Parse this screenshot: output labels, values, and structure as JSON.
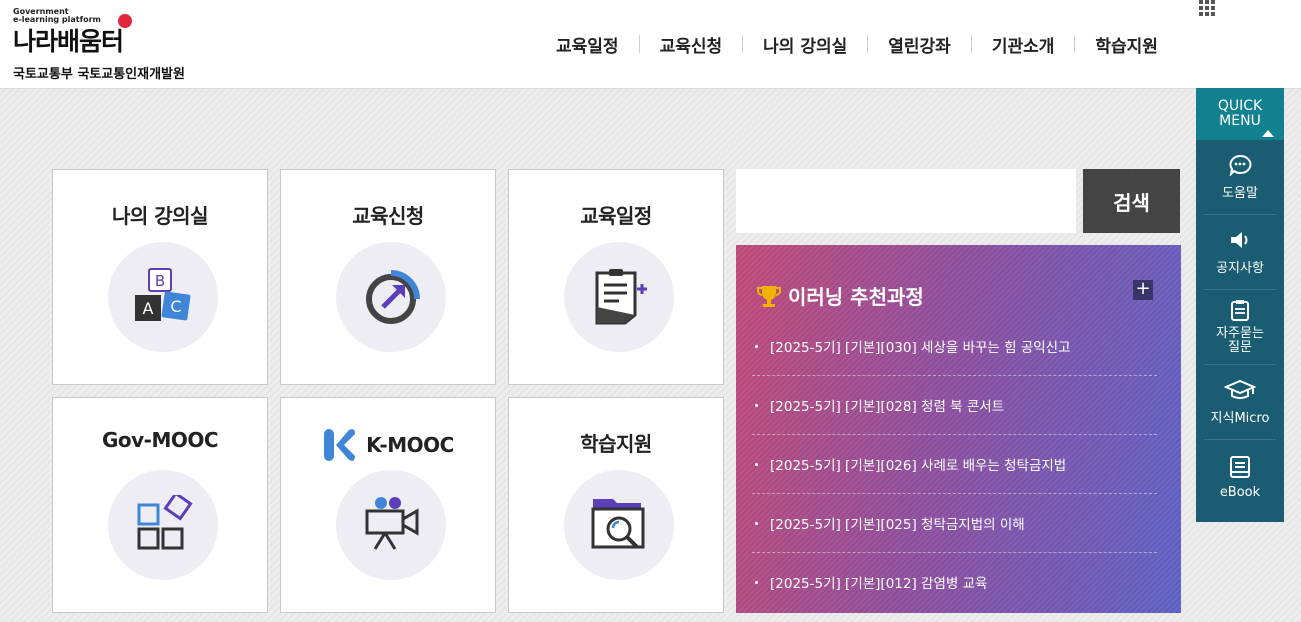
{
  "header": {
    "logo_gov": "Government",
    "logo_sub": "e-learning platform",
    "logo_main": "나라배움터",
    "org": "국토교통부 국토교통인재개발원",
    "nav": [
      "교육일정",
      "교육신청",
      "나의 강의실",
      "열린강좌",
      "기관소개",
      "학습지원"
    ]
  },
  "cards": [
    {
      "title": "나의 강의실",
      "icon": "abc-blocks-icon"
    },
    {
      "title": "교육신청",
      "icon": "progress-arrow-icon"
    },
    {
      "title": "교육일정",
      "icon": "schedule-doc-icon"
    },
    {
      "title": "Gov-MOOC",
      "icon": "shapes-icon"
    },
    {
      "title": "K-MOOC",
      "icon": "video-camera-icon"
    },
    {
      "title": "학습지원",
      "icon": "folder-search-icon"
    }
  ],
  "search": {
    "placeholder": "",
    "button": "검색"
  },
  "recommend": {
    "title": "이러닝 추천과정",
    "plus": "+",
    "items": [
      "[2025-5기] [기본][030] 세상을 바꾸는 힘 공익신고",
      "[2025-5기] [기본][028] 청렴 북 콘서트",
      "[2025-5기] [기본][026] 사례로 배우는 청탁금지법",
      "[2025-5기] [기본][025] 청탁금지법의 이해",
      "[2025-5기] [기본][012] 감염병 교육"
    ]
  },
  "quick": {
    "title_line1": "QUICK",
    "title_line2": "MENU",
    "items": [
      {
        "label": "도움말",
        "icon": "chat-icon"
      },
      {
        "label": "공지사항",
        "icon": "speaker-icon"
      },
      {
        "label": "자주묻는 질문",
        "icon": "faq-doc-icon"
      },
      {
        "label": "지식Micro",
        "icon": "graduation-cap-icon"
      },
      {
        "label": "eBook",
        "icon": "ebook-icon"
      }
    ]
  },
  "colors": {
    "accent_teal": "#11808f",
    "quick_bg": "#1a5d72",
    "panel_start": "#c24a78",
    "panel_end": "#5f62c7",
    "icon_purple": "#5b3fb8",
    "icon_blue": "#3f86d8"
  }
}
